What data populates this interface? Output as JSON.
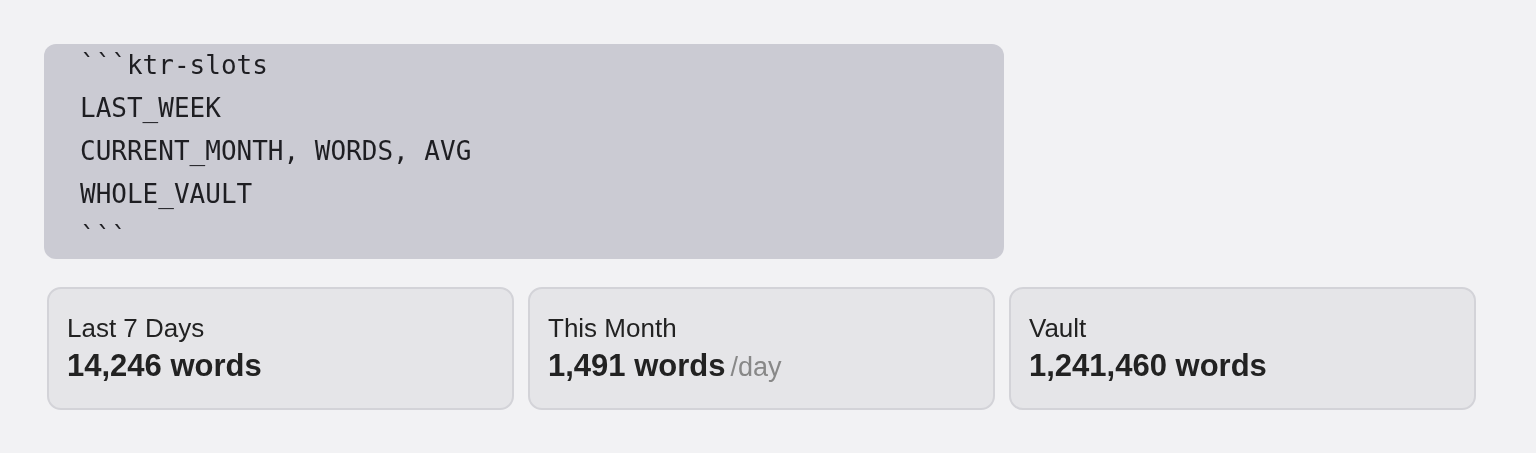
{
  "code_block": {
    "lines": [
      "```ktr-slots",
      "LAST_WEEK",
      "CURRENT_MONTH, WORDS, AVG",
      "WHOLE_VAULT",
      "```"
    ]
  },
  "stats": [
    {
      "label": "Last 7 Days",
      "value": "14,246 words"
    },
    {
      "label": "This Month",
      "value": "1,491 words",
      "unit": "/day"
    },
    {
      "label": "Vault",
      "value": "1,241,460 words"
    }
  ]
}
